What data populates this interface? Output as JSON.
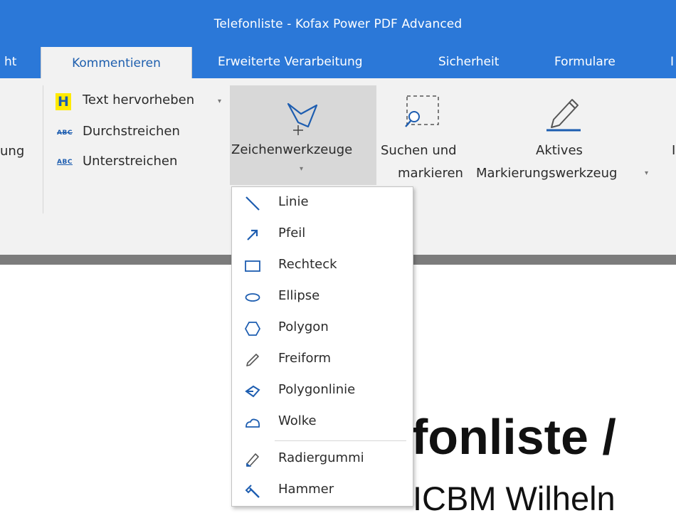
{
  "window": {
    "title": "Telefonliste - Kofax Power PDF Advanced"
  },
  "tabs": [
    {
      "label": "ht",
      "active": false
    },
    {
      "label": "Kommentieren",
      "active": true
    },
    {
      "label": "Erweiterte Verarbeitung",
      "active": false
    },
    {
      "label": "Sicherheit",
      "active": false
    },
    {
      "label": "Formulare",
      "active": false
    },
    {
      "label": "I",
      "active": false
    }
  ],
  "ribbon": {
    "left_cut_label": "ung",
    "text_group": {
      "highlight_icon_letter": "H",
      "highlight_label": "Text hervorheben",
      "strike_icon_text": "ABC",
      "strike_label": "Durchstreichen",
      "underline_icon_text": "ABC",
      "underline_label": "Unterstreichen"
    },
    "drawing_tools": {
      "label": "Zeichenwerkzeuge",
      "icon": "polygon-pen-icon"
    },
    "search_mark": {
      "label_line1": "Suchen und",
      "label_line2": "markieren",
      "icon": "search-select-icon"
    },
    "active_marker": {
      "label_line1": "Aktives",
      "label_line2": "Markierungswerkzeug",
      "icon": "pencil-icon"
    },
    "right_cut_label": "I"
  },
  "drawing_menu": {
    "items": [
      {
        "label": "Linie",
        "icon": "line-icon"
      },
      {
        "label": "Pfeil",
        "icon": "arrow-icon"
      },
      {
        "label": "Rechteck",
        "icon": "rectangle-icon"
      },
      {
        "label": "Ellipse",
        "icon": "ellipse-icon"
      },
      {
        "label": "Polygon",
        "icon": "polygon-icon"
      },
      {
        "label": "Freiform",
        "icon": "freeform-pencil-icon"
      },
      {
        "label": "Polygonlinie",
        "icon": "polyline-icon"
      },
      {
        "label": "Wolke",
        "icon": "cloud-icon"
      },
      {
        "label": "Radiergummi",
        "icon": "eraser-icon"
      },
      {
        "label": "Hammer",
        "icon": "hammer-icon"
      }
    ]
  },
  "document": {
    "heading_fragment": "fonliste /",
    "subheading_fragment": "ICBM Wilheln"
  },
  "colors": {
    "title_blue": "#2b78d8",
    "icon_blue": "#1d5db0",
    "highlight_yellow": "#ffea00"
  }
}
